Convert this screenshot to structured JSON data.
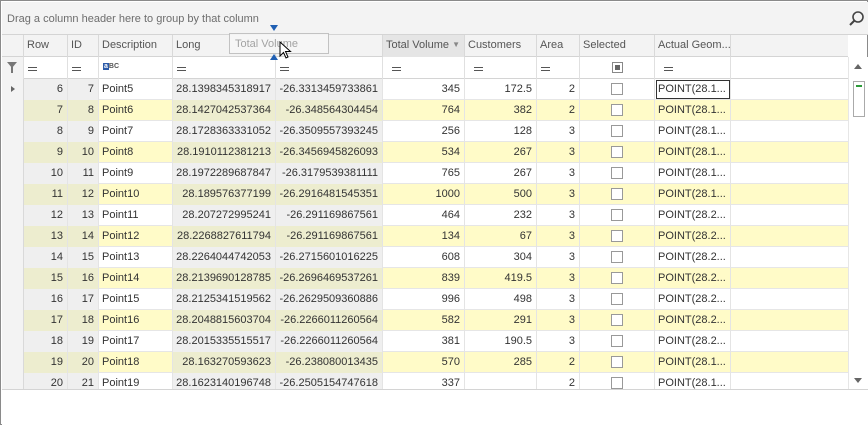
{
  "group_panel": {
    "hint": "Drag a column header here to group by that column"
  },
  "icons": {
    "search": "search-icon",
    "filter": "funnel-icon",
    "row_indicator": "triangle-right-icon",
    "string_filter": "abc-icon",
    "equals": "equals-icon"
  },
  "colors": {
    "alt_row": "#fffbc8",
    "drop_marker": "#1f5fb3",
    "sorted_header": "#e5e5e5"
  },
  "drag_ghost": {
    "label": "Total Volume"
  },
  "columns": [
    {
      "key": "row",
      "label": "Row"
    },
    {
      "key": "id",
      "label": "ID"
    },
    {
      "key": "desc",
      "label": "Description"
    },
    {
      "key": "long",
      "label": "Long"
    },
    {
      "key": "lat",
      "label": ""
    },
    {
      "key": "total",
      "label": "Total Volume"
    },
    {
      "key": "cust",
      "label": "Customers"
    },
    {
      "key": "area",
      "label": "Area"
    },
    {
      "key": "sel",
      "label": "Selected"
    },
    {
      "key": "geom",
      "label": "Actual Geom..."
    }
  ],
  "rows": [
    {
      "row": "6",
      "id": "7",
      "desc": "Point5",
      "long": "28.1398345318917",
      "lat": "-26.3313459733861",
      "total": "345",
      "cust": "172.5",
      "area": "2",
      "geom": "POINT(28.1..."
    },
    {
      "row": "7",
      "id": "8",
      "desc": "Point6",
      "long": "28.1427042537364",
      "lat": "-26.348564304454",
      "total": "764",
      "cust": "382",
      "area": "2",
      "geom": "POINT(28.1..."
    },
    {
      "row": "8",
      "id": "9",
      "desc": "Point7",
      "long": "28.1728363331052",
      "lat": "-26.3509557393245",
      "total": "256",
      "cust": "128",
      "area": "3",
      "geom": "POINT(28.1..."
    },
    {
      "row": "9",
      "id": "10",
      "desc": "Point8",
      "long": "28.1910112381213",
      "lat": "-26.3456945826093",
      "total": "534",
      "cust": "267",
      "area": "3",
      "geom": "POINT(28.1..."
    },
    {
      "row": "10",
      "id": "11",
      "desc": "Point9",
      "long": "28.1972289687847",
      "lat": "-26.3179539381111",
      "total": "765",
      "cust": "267",
      "area": "3",
      "geom": "POINT(28.1..."
    },
    {
      "row": "11",
      "id": "12",
      "desc": "Point10",
      "long": "28.189576377199",
      "lat": "-26.2916481545351",
      "total": "1000",
      "cust": "500",
      "area": "3",
      "geom": "POINT(28.1..."
    },
    {
      "row": "12",
      "id": "13",
      "desc": "Point11",
      "long": "28.207272995241",
      "lat": "-26.291169867561",
      "total": "464",
      "cust": "232",
      "area": "3",
      "geom": "POINT(28.2..."
    },
    {
      "row": "13",
      "id": "14",
      "desc": "Point12",
      "long": "28.2268827611794",
      "lat": "-26.291169867561",
      "total": "134",
      "cust": "67",
      "area": "3",
      "geom": "POINT(28.2..."
    },
    {
      "row": "14",
      "id": "15",
      "desc": "Point13",
      "long": "28.2264044742053",
      "lat": "-26.2715601016225",
      "total": "608",
      "cust": "304",
      "area": "3",
      "geom": "POINT(28.2..."
    },
    {
      "row": "15",
      "id": "16",
      "desc": "Point14",
      "long": "28.2139690128785",
      "lat": "-26.2696469537261",
      "total": "839",
      "cust": "419.5",
      "area": "3",
      "geom": "POINT(28.2..."
    },
    {
      "row": "16",
      "id": "17",
      "desc": "Point15",
      "long": "28.2125341519562",
      "lat": "-26.2629509360886",
      "total": "996",
      "cust": "498",
      "area": "3",
      "geom": "POINT(28.2..."
    },
    {
      "row": "17",
      "id": "18",
      "desc": "Point16",
      "long": "28.2048815603704",
      "lat": "-26.2266011260564",
      "total": "582",
      "cust": "291",
      "area": "3",
      "geom": "POINT(28.2..."
    },
    {
      "row": "18",
      "id": "19",
      "desc": "Point17",
      "long": "28.2015335515517",
      "lat": "-26.2266011260564",
      "total": "381",
      "cust": "190.5",
      "area": "3",
      "geom": "POINT(28.2..."
    },
    {
      "row": "19",
      "id": "20",
      "desc": "Point18",
      "long": "28.163270593623",
      "lat": "-26.238080013435",
      "total": "570",
      "cust": "285",
      "area": "2",
      "geom": "POINT(28.1..."
    },
    {
      "row": "20",
      "id": "21",
      "desc": "Point19",
      "long": "28.1623140196748",
      "lat": "-26.2505154747618",
      "total": "337",
      "cust": "",
      "area": "2",
      "geom": "POINT(28.1..."
    }
  ]
}
